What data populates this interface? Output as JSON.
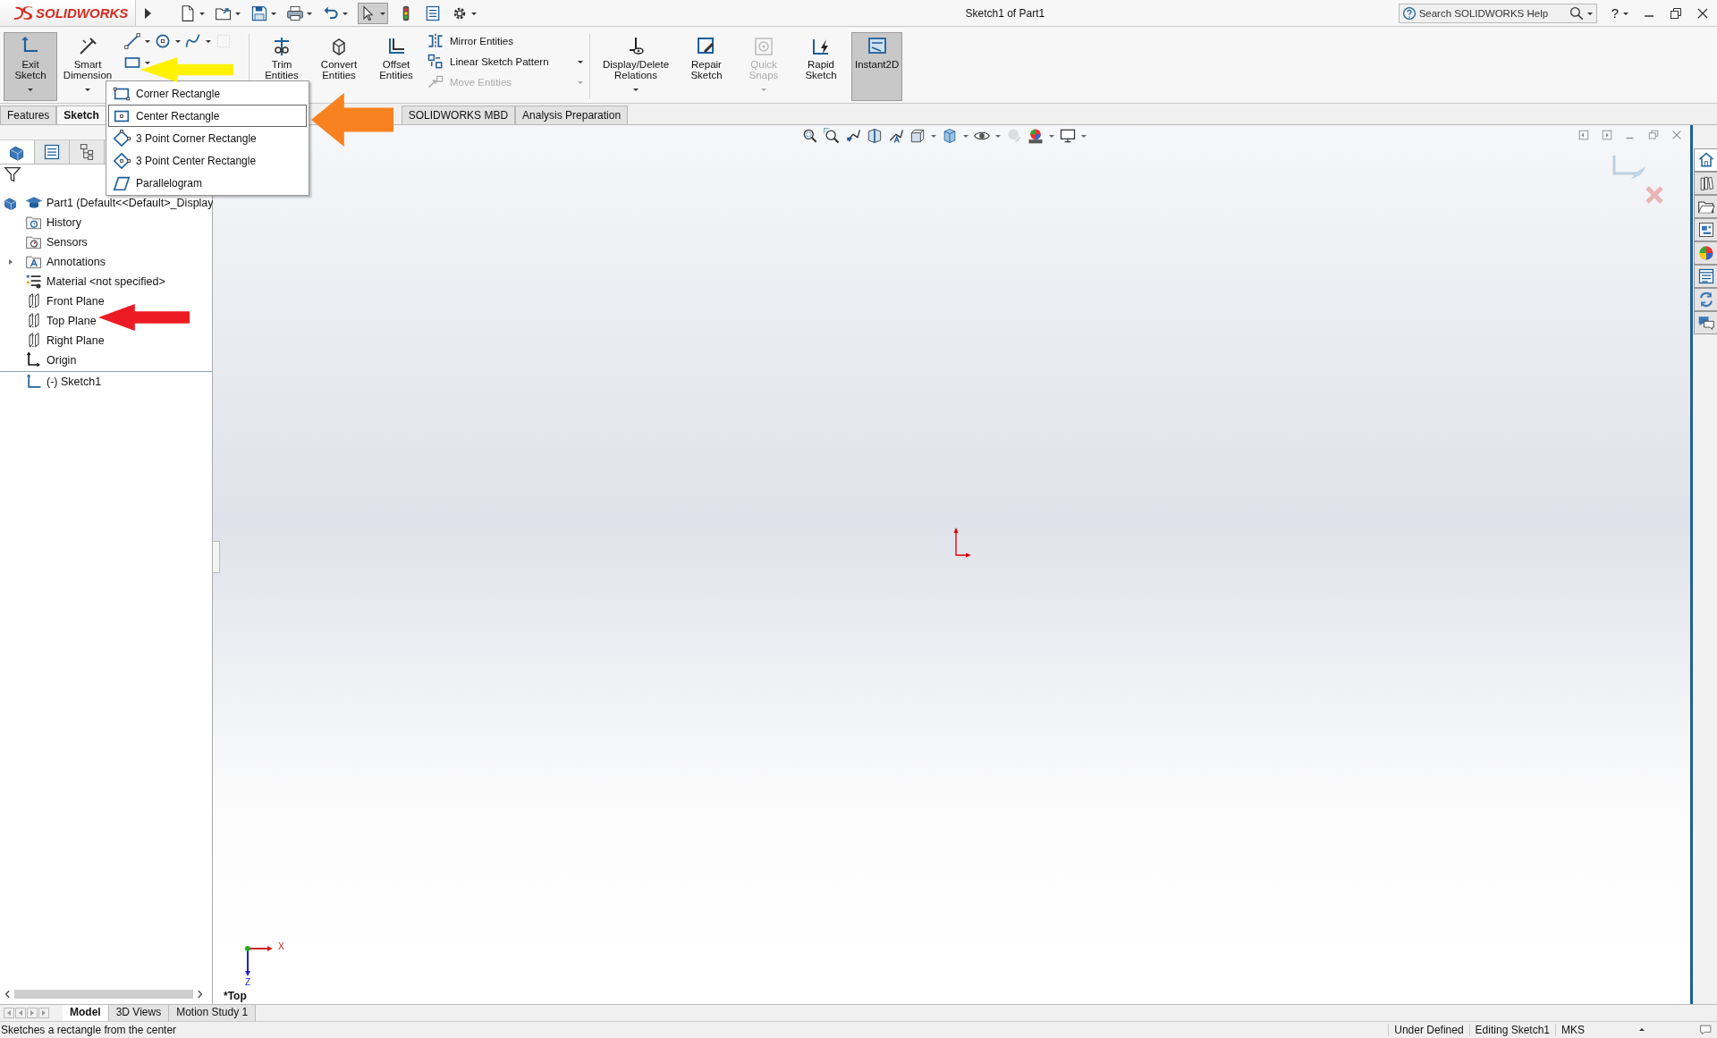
{
  "title_bar": {
    "logo_text": "SOLIDWORKS",
    "document_title": "Sketch1 of Part1",
    "search": {
      "placeholder": "Search SOLIDWORKS Help"
    },
    "help_label": "?"
  },
  "ribbon": {
    "left_buttons": [
      {
        "label": "Exit Sketch",
        "pressed": true,
        "disabled": false,
        "dropdown": true
      },
      {
        "label": "Smart Dimension",
        "pressed": false,
        "disabled": false,
        "dropdown": true
      }
    ],
    "edit_buttons": [
      {
        "label": "Trim Entities",
        "pressed": false,
        "disabled": false,
        "dropdown": false
      },
      {
        "label": "Convert Entities",
        "pressed": false,
        "disabled": false,
        "dropdown": false
      },
      {
        "label": "Offset Entities",
        "pressed": false,
        "disabled": false,
        "dropdown": false
      }
    ],
    "list_buttons": [
      {
        "label": "Mirror Entities",
        "disabled": false,
        "dropdown": false
      },
      {
        "label": "Linear Sketch Pattern",
        "disabled": false,
        "dropdown": true
      },
      {
        "label": "Move Entities",
        "disabled": true,
        "dropdown": true
      }
    ],
    "right_buttons": [
      {
        "label": "Display/Delete Relations",
        "pressed": false,
        "disabled": false,
        "dropdown": true
      },
      {
        "label": "Repair Sketch",
        "pressed": false,
        "disabled": false,
        "dropdown": false
      },
      {
        "label": "Quick Snaps",
        "pressed": false,
        "disabled": true,
        "dropdown": true
      },
      {
        "label": "Rapid Sketch",
        "pressed": false,
        "disabled": false,
        "dropdown": false
      },
      {
        "label": "Instant2D",
        "pressed": true,
        "disabled": false,
        "dropdown": false
      }
    ]
  },
  "command_tabs": [
    {
      "label": "Features",
      "selected": false
    },
    {
      "label": "Sketch",
      "selected": true
    },
    {
      "label": "SOLIDWORKS MBD",
      "selected": false
    },
    {
      "label": "Analysis Preparation",
      "selected": false
    }
  ],
  "rectangle_menu": [
    {
      "label": "Corner Rectangle",
      "selected": false
    },
    {
      "label": "Center Rectangle",
      "selected": true
    },
    {
      "label": "3 Point Corner Rectangle",
      "selected": false
    },
    {
      "label": "3 Point Center Rectangle",
      "selected": false
    },
    {
      "label": "Parallelogram",
      "selected": false
    }
  ],
  "manager_tabs": [
    {
      "selected": true
    },
    {
      "selected": false
    },
    {
      "selected": false
    }
  ],
  "feature_tree": [
    {
      "label": "Part1  (Default<<Default>_Display",
      "kind": "part"
    },
    {
      "label": "History",
      "kind": "history"
    },
    {
      "label": "Sensors",
      "kind": "sensors"
    },
    {
      "label": "Annotations",
      "kind": "annotations",
      "expanded": false
    },
    {
      "label": "Material <not specified>",
      "kind": "material"
    },
    {
      "label": "Front Plane",
      "kind": "plane"
    },
    {
      "label": "Top Plane",
      "kind": "plane"
    },
    {
      "label": "Right Plane",
      "kind": "plane"
    },
    {
      "label": "Origin",
      "kind": "origin"
    },
    {
      "label": "(-) Sketch1",
      "kind": "sketch"
    }
  ],
  "viewport": {
    "view_label": "*Top",
    "triad": {
      "x_label": "X",
      "z_label": "Z"
    }
  },
  "annotations": [
    {
      "color": "#fff200"
    },
    {
      "color": "#f7821f"
    },
    {
      "color": "#ed1c24"
    }
  ],
  "bottom_tabs": [
    {
      "label": "Model",
      "selected": true
    },
    {
      "label": "3D Views",
      "selected": false
    },
    {
      "label": "Motion Study 1",
      "selected": false
    }
  ],
  "status_bar": {
    "message": "Sketches a rectangle from the center",
    "fields": [
      "Under Defined",
      "Editing Sketch1",
      "MKS"
    ]
  }
}
